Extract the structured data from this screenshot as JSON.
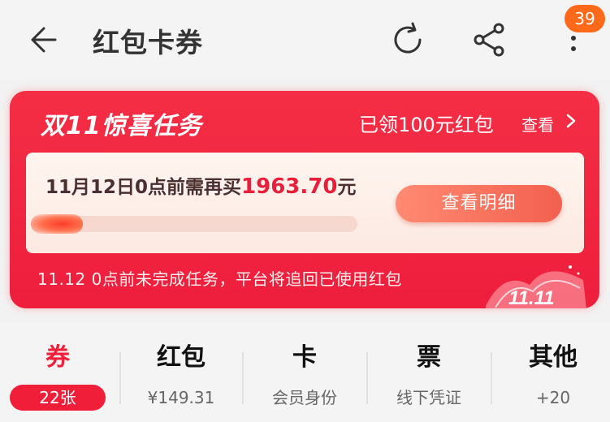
{
  "header": {
    "title": "红包卡券",
    "badge_count": "39"
  },
  "card": {
    "title": "双11惊喜任务",
    "claimed": "已领100元红包",
    "view": "查看",
    "need_prefix": "11月12日0点前需再买",
    "need_amount": "1963.70",
    "need_unit": "元",
    "detail_button": "查看明细",
    "progress_fraction": 0.16,
    "note": "11.12 0点前未完成任务，平台将追回已使用红包",
    "deco_text": "11.11"
  },
  "tabs": [
    {
      "label": "券",
      "sub": "22张",
      "active": true
    },
    {
      "label": "红包",
      "sub": "¥149.31",
      "active": false
    },
    {
      "label": "卡",
      "sub": "会员身份",
      "active": false
    },
    {
      "label": "票",
      "sub": "线下凭证",
      "active": false
    },
    {
      "label": "其他",
      "sub": "+20",
      "active": false
    }
  ],
  "colors": {
    "accent": "#f11e3a",
    "badge": "#ff6a1a",
    "card_bg": "#f42e45"
  },
  "icons": [
    "back-arrow-icon",
    "refresh-icon",
    "share-icon",
    "more-vertical-icon",
    "chevron-right-icon"
  ]
}
